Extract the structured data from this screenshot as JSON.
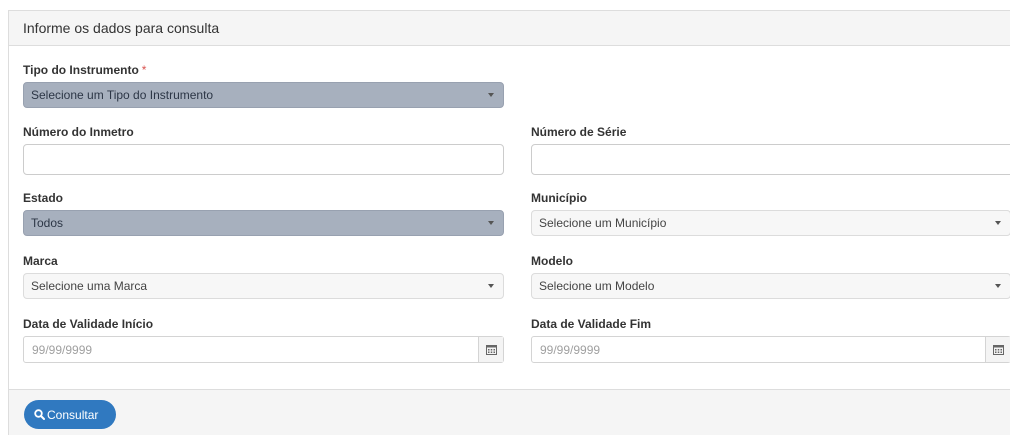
{
  "panel": {
    "heading": "Informe os dados para consulta"
  },
  "form": {
    "tipo_instrumento": {
      "label": "Tipo do Instrumento",
      "required_mark": "*",
      "value": "Selecione um Tipo do Instrumento"
    },
    "numero_inmetro": {
      "label": "Número do Inmetro",
      "value": ""
    },
    "numero_serie": {
      "label": "Número de Série",
      "value": ""
    },
    "estado": {
      "label": "Estado",
      "value": "Todos"
    },
    "municipio": {
      "label": "Município",
      "value": "Selecione um Município"
    },
    "marca": {
      "label": "Marca",
      "value": "Selecione uma Marca"
    },
    "modelo": {
      "label": "Modelo",
      "value": "Selecione um Modelo"
    },
    "data_inicio": {
      "label": "Data de Validade Início",
      "placeholder": "99/99/9999"
    },
    "data_fim": {
      "label": "Data de Validade Fim",
      "placeholder": "99/99/9999"
    }
  },
  "footer": {
    "consultar_label": "Consultar"
  },
  "icons": {
    "search": "search-icon",
    "calendar": "calendar-icon",
    "dropdown": "chevron-down-icon"
  },
  "colors": {
    "primary_button": "#3079c0",
    "selected_select_bg": "#a7b0be",
    "required": "#d9534f"
  }
}
